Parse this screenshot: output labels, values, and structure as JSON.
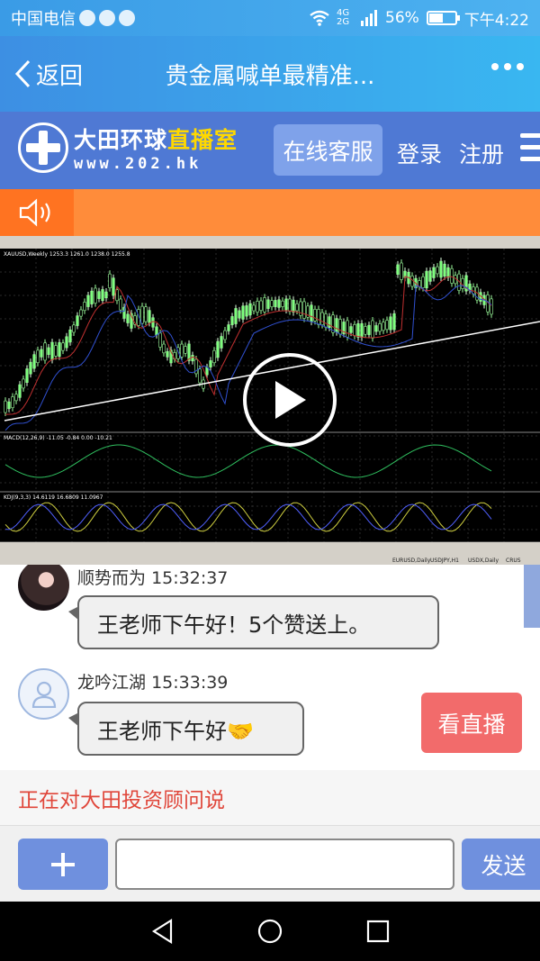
{
  "status_bar": {
    "carrier": "中国电信",
    "network": "4G 2G",
    "battery_percent": "56%",
    "battery_level": 0.56,
    "time": "下午4:22"
  },
  "nav": {
    "back_label": "返回",
    "title": "贵金属喊单最精准..."
  },
  "site_header": {
    "logo_name": "大田环球",
    "logo_highlight": "直播室",
    "logo_url": "www.202.hk",
    "service_label": "在线客服",
    "login_label": "登录",
    "register_label": "注册"
  },
  "video": {
    "chart_title": "XAUUSD,Weekly  1253.3 1261.0 1238.0 1255.8",
    "indicator_1": "MACD(12,26,9) -11.05 -0.84 0.00 -10.21",
    "indicator_2": "KDJ(9,3,3) 14.6119 16.6809 11.0967",
    "bottom_tabs": [
      "EURUSD,Daily",
      "USDJPY,H1",
      "USDX,Daily",
      "CRUS"
    ]
  },
  "chat": {
    "messages": [
      {
        "user": "顺势而为",
        "time": "15:32:37",
        "text": "王老师下午好！5个赞送上。"
      },
      {
        "user": "龙吟江湖",
        "time": "15:33:39",
        "text": "王老师下午好🤝"
      }
    ],
    "watch_live_label": "看直播"
  },
  "talk_target": "正在对大田投资顾问说",
  "composer": {
    "plus_label": "+",
    "input_value": "",
    "send_label": "发送"
  },
  "colors": {
    "nav_blue": "#3d8fe3",
    "header_blue": "#4f79d4",
    "notice_orange": "#ff8c3a",
    "watch_red": "#f26b6b",
    "button_blue": "#6f90de",
    "talk_red": "#e0463a"
  }
}
